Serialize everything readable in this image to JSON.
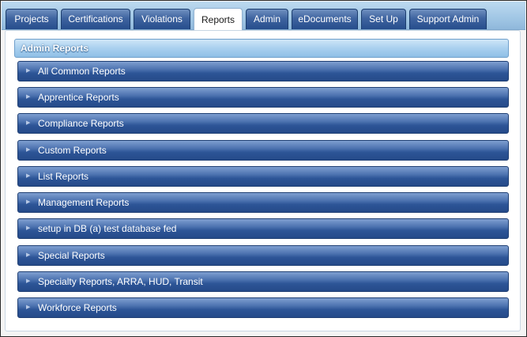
{
  "tabs": [
    {
      "label": "Projects",
      "active": false
    },
    {
      "label": "Certifications",
      "active": false
    },
    {
      "label": "Violations",
      "active": false
    },
    {
      "label": "Reports",
      "active": true
    },
    {
      "label": "Admin",
      "active": false
    },
    {
      "label": "eDocuments",
      "active": false
    },
    {
      "label": "Set Up",
      "active": false
    },
    {
      "label": "Support Admin",
      "active": false
    }
  ],
  "section": {
    "title": "Admin Reports",
    "items": [
      {
        "label": "All Common Reports"
      },
      {
        "label": "Apprentice Reports"
      },
      {
        "label": "Compliance Reports"
      },
      {
        "label": "Custom Reports"
      },
      {
        "label": "List Reports"
      },
      {
        "label": "Management Reports"
      },
      {
        "label": "setup in DB (a) test database fed"
      },
      {
        "label": "Special Reports"
      },
      {
        "label": "Specialty Reports, ARRA, HUD, Transit"
      },
      {
        "label": "Workforce Reports"
      }
    ]
  },
  "icons": {
    "expand_arrow": "triangle-right"
  },
  "colors": {
    "tab_bar": "#a3c8e6",
    "tab": "#264d8c",
    "active_tab": "#ffffff",
    "report_bar": "#2d5597",
    "section_header": "#a9d0ef"
  }
}
